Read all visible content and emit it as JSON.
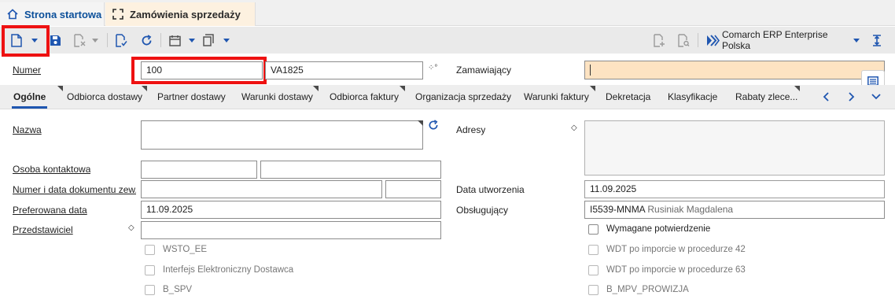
{
  "tabs": {
    "home": "Strona startowa",
    "active": "Zamówienia sprzedaży"
  },
  "toolbar": {
    "company": "Comarch ERP Enterprise Polska"
  },
  "header": {
    "numer_label": "Numer",
    "numer_value": "100",
    "numer_code": "VA1825",
    "zamawiajacy_label": "Zamawiający",
    "zamawiajacy_value": ""
  },
  "section_tabs": [
    "Ogólne",
    "Odbiorca dostawy",
    "Partner dostawy",
    "Warunki dostawy",
    "Odbiorca faktury",
    "Organizacja sprzedaży",
    "Warunki faktury",
    "Dekretacja",
    "Klasyfikacje",
    "Rabaty zlece..."
  ],
  "form": {
    "nazwa_label": "Nazwa",
    "adresy_label": "Adresy",
    "osoba_label": "Osoba kontaktowa",
    "numer_dok_label": "Numer i data dokumentu zew...",
    "data_utworzenia_label": "Data utworzenia",
    "data_utworzenia_value": "11.09.2025",
    "pref_data_label": "Preferowana data",
    "pref_data_value": "11.09.2025",
    "obslugujacy_label": "Obsługujący",
    "obslugujacy_code": "I5539-MNMA",
    "obslugujacy_name": "Rusiniak Magdalena",
    "przedstawiciel_label": "Przedstawiciel"
  },
  "checkboxes_left": [
    {
      "label": "WSTO_EE",
      "checked": false,
      "disabled": true
    },
    {
      "label": "Interfejs Elektroniczny Dostawca",
      "checked": false,
      "disabled": true
    },
    {
      "label": "B_SPV",
      "checked": false,
      "disabled": true
    }
  ],
  "checkboxes_right": [
    {
      "label": "Wymagane potwierdzenie",
      "checked": false,
      "disabled": false
    },
    {
      "label": "WDT po imporcie w procedurze 42",
      "checked": false,
      "disabled": true
    },
    {
      "label": "WDT po imporcie w procedurze 63",
      "checked": false,
      "disabled": true
    },
    {
      "label": "B_MPV_PROWIZJA",
      "checked": false,
      "disabled": true
    }
  ],
  "colors": {
    "accent": "#1f56b0",
    "highlight_field": "#fde3c2",
    "annotation_red": "#ee1111"
  }
}
